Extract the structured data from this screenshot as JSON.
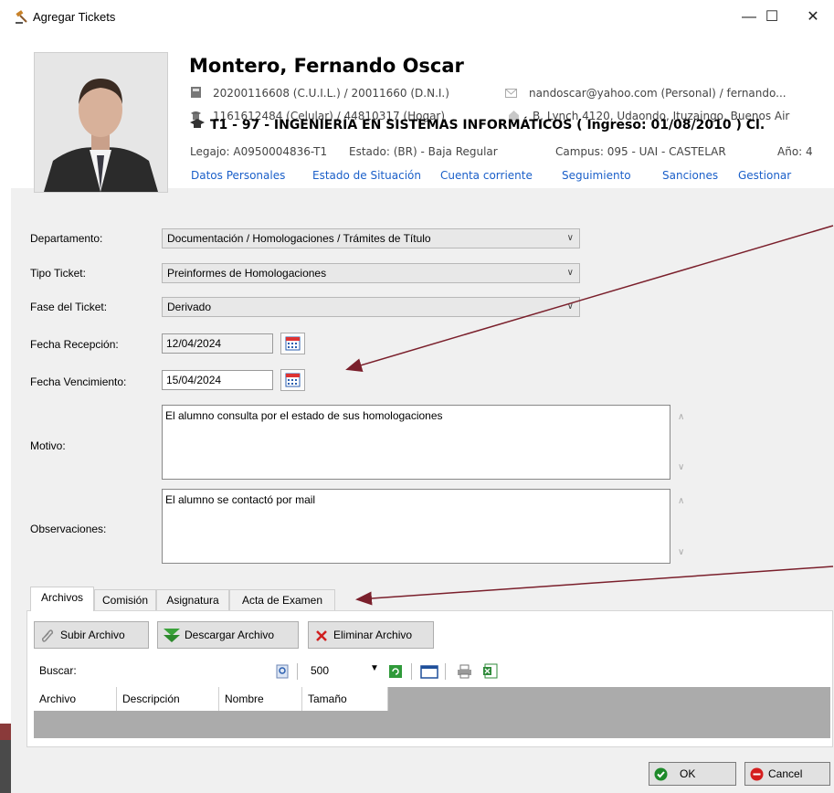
{
  "window": {
    "title": "Agregar Tickets",
    "controls": {
      "minimize": "—",
      "maximize": "☐",
      "close": "✕"
    }
  },
  "student": {
    "name": "Montero, Fernando Oscar",
    "ids": "20200116608 (C.U.I.L.) / 20011660 (D.N.I.)",
    "email": "nandoscar@yahoo.com (Personal) / fernando...",
    "phones": "1161612484 (Celular) / 44810317 (Hogar)",
    "address": "B. Lynch 4120, Udaondo, Ituzaingo, Buenos Air",
    "career": "T1 - 97 - INGENIERÍA EN SISTEMAS INFORMÁTICOS   ( Ingreso: 01/08/2010 ) Cl.",
    "legajo": "Legajo: A0950004836-T1",
    "estado": "Estado: (BR) - Baja Regular",
    "campus": "Campus: 095 - UAI - CASTELAR",
    "anio": "Año: 4",
    "links": [
      "Datos Personales",
      "Estado de Situación",
      "Cuenta corriente",
      "Seguimiento",
      "Sanciones",
      "Gestionar"
    ]
  },
  "form": {
    "departamento": {
      "label": "Departamento:",
      "value": "Documentación / Homologaciones / Trámites de Título"
    },
    "tipo": {
      "label": "Tipo Ticket:",
      "value": "Preinformes de Homologaciones"
    },
    "fase": {
      "label": "Fase del Ticket:",
      "value": "Derivado"
    },
    "fecha_recepcion": {
      "label": "Fecha Recepción:",
      "value": "12/04/2024"
    },
    "fecha_vencimiento": {
      "label": "Fecha Vencimiento:",
      "value": "15/04/2024"
    },
    "motivo": {
      "label": "Motivo:",
      "value": "El alumno consulta por el estado de sus homologaciones"
    },
    "observaciones": {
      "label": "Observaciones:",
      "value": "El alumno se contactó por mail"
    }
  },
  "tabs": [
    "Archivos",
    "Comisión",
    "Asignatura",
    "Acta de Examen"
  ],
  "toolbar": {
    "upload": "Subir Archivo",
    "download": "Descargar Archivo",
    "delete": "Eliminar Archivo"
  },
  "search": {
    "label": "Buscar:",
    "page_size": "500"
  },
  "grid": {
    "columns": [
      "Archivo",
      "Descripción",
      "Nombre",
      "Tamaño"
    ]
  },
  "footer": {
    "ok": "OK",
    "cancel": "Cancel"
  },
  "colors": {
    "link": "#1a5fc9",
    "arrow": "#7a1f2b"
  }
}
